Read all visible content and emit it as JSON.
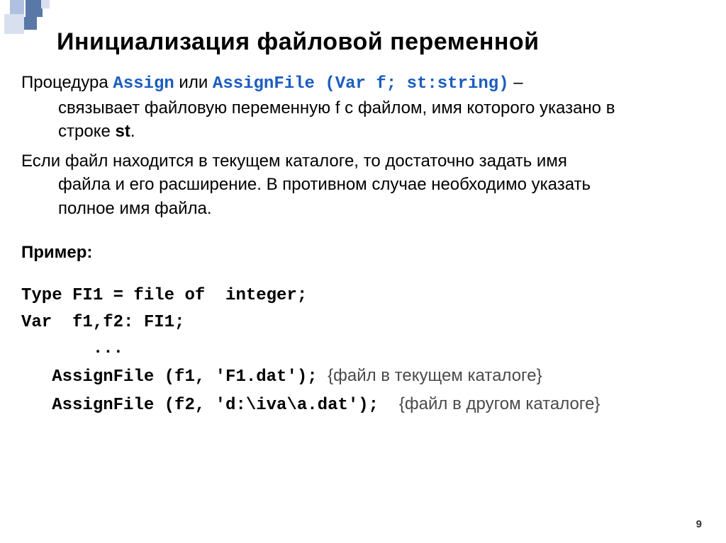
{
  "title": "Инициализация файловой переменной",
  "para1": {
    "lead": "Процедура ",
    "kw1": "Assign",
    "mid1": " или ",
    "kw2": "AssignFile (Var f; st:string)",
    "tail1": " – ",
    "line2": "связывает файловую переменную f с файлом, имя которого указано в",
    "line3a": "строке ",
    "line3b": "st",
    "line3c": "."
  },
  "para2": {
    "line1": "Если файл находится в текущем каталоге, то достаточно задать имя",
    "line2": "файла и его расширение. В противном случае необходимо указать",
    "line3": "полное имя файла."
  },
  "example_label": "Пример:",
  "code": {
    "l1": "Type FI1 = file of  integer;",
    "l2": "Var  f1,f2: FI1;",
    "l3": "       ...",
    "l4a": "   AssignFile (f1, 'F1.dat'); ",
    "l4b": "{файл в текущем каталоге}",
    "l5a": "   AssignFile (f2, 'd:\\iva\\a.dat');  ",
    "l5b": "{файл в другом каталоге}"
  },
  "page_number": "9"
}
